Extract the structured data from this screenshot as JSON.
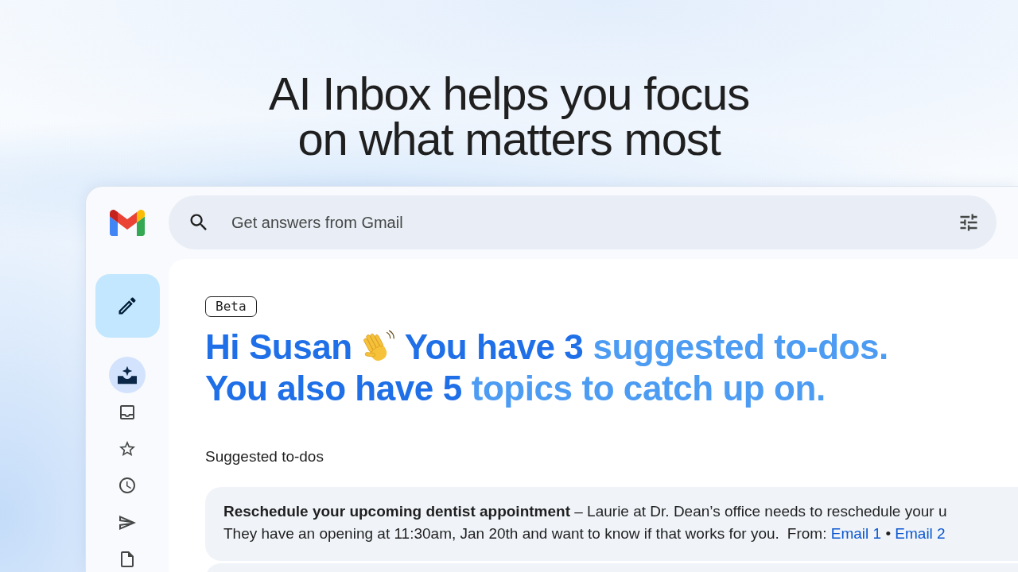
{
  "headline": "AI Inbox helps you focus on what matters most",
  "app": {
    "search": {
      "placeholder": "Get answers from Gmail"
    },
    "nav": [
      {
        "kind": "ai_inbox",
        "selected": true
      },
      {
        "kind": "inbox",
        "selected": false
      },
      {
        "kind": "starred",
        "selected": false
      },
      {
        "kind": "snoozed",
        "selected": false
      },
      {
        "kind": "sent",
        "selected": false
      },
      {
        "kind": "drafts",
        "selected": false
      }
    ],
    "badge": "Beta",
    "greeting": [
      {
        "segments": [
          {
            "kind": "strong",
            "text": "Hi Susan"
          },
          {
            "kind": "wave"
          },
          {
            "kind": "strong",
            "text": "You have 3"
          },
          {
            "kind": "light",
            "text": "suggested to-dos."
          }
        ]
      },
      {
        "segments": [
          {
            "kind": "strong",
            "text": "You also have 5"
          },
          {
            "kind": "light",
            "text": "topics to catch up on."
          }
        ]
      }
    ],
    "section_title": "Suggested to-dos",
    "todos": [
      {
        "title": "Reschedule your upcoming dentist appointment",
        "summary": "– Laurie at Dr. Dean’s office needs to reschedule your u",
        "details": "They have an opening at 11:30am, Jan 20th and want to know if that works for you.",
        "from_label": "From:",
        "sources": [
          "Email 1",
          "Email 2"
        ],
        "separator": "•"
      }
    ]
  }
}
